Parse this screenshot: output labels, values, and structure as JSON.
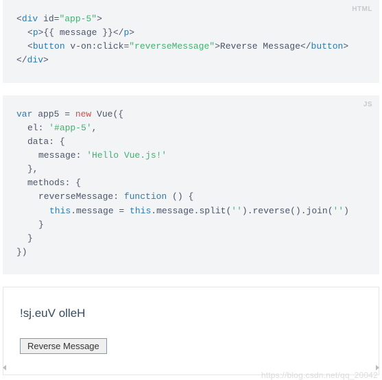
{
  "blocks": {
    "html": {
      "badge": "HTML",
      "lines": [
        {
          "indent": 0,
          "parts": [
            [
              "punct",
              "<"
            ],
            [
              "tag",
              "div "
            ],
            [
              "attr-name",
              "id"
            ],
            [
              "punct",
              "="
            ],
            [
              "attr-value",
              "\"app-5\""
            ],
            [
              "punct",
              ">"
            ]
          ]
        },
        {
          "indent": 1,
          "parts": [
            [
              "punct",
              "<"
            ],
            [
              "tag",
              "p"
            ],
            [
              "punct",
              ">"
            ],
            [
              "text",
              "{{ message }}"
            ],
            [
              "punct",
              "</"
            ],
            [
              "tag",
              "p"
            ],
            [
              "punct",
              ">"
            ]
          ]
        },
        {
          "indent": 1,
          "parts": [
            [
              "punct",
              "<"
            ],
            [
              "tag",
              "button "
            ],
            [
              "attr-name",
              "v-on:click"
            ],
            [
              "punct",
              "="
            ],
            [
              "attr-value",
              "\"reverseMessage\""
            ],
            [
              "punct",
              ">"
            ],
            [
              "text",
              "Reverse Message"
            ],
            [
              "punct",
              "</"
            ],
            [
              "tag",
              "button"
            ],
            [
              "punct",
              ">"
            ]
          ]
        },
        {
          "indent": 0,
          "parts": [
            [
              "punct",
              "</"
            ],
            [
              "tag",
              "div"
            ],
            [
              "punct",
              ">"
            ]
          ]
        }
      ]
    },
    "js": {
      "badge": "JS",
      "lines": [
        {
          "indent": 0,
          "parts": [
            [
              "keyword",
              "var"
            ],
            [
              "text",
              " app5 = "
            ],
            [
              "keyword2",
              "new"
            ],
            [
              "text",
              " Vue({"
            ]
          ]
        },
        {
          "indent": 1,
          "parts": [
            [
              "prop",
              "el"
            ],
            [
              "text",
              ": "
            ],
            [
              "string",
              "'#app-5'"
            ],
            [
              "text",
              ","
            ]
          ]
        },
        {
          "indent": 1,
          "parts": [
            [
              "prop",
              "data"
            ],
            [
              "text",
              ": {"
            ]
          ]
        },
        {
          "indent": 2,
          "parts": [
            [
              "prop",
              "message"
            ],
            [
              "text",
              ": "
            ],
            [
              "string",
              "'Hello Vue.js!'"
            ]
          ]
        },
        {
          "indent": 1,
          "parts": [
            [
              "text",
              "},"
            ]
          ]
        },
        {
          "indent": 1,
          "parts": [
            [
              "prop",
              "methods"
            ],
            [
              "text",
              ": {"
            ]
          ]
        },
        {
          "indent": 2,
          "parts": [
            [
              "prop",
              "reverseMessage"
            ],
            [
              "text",
              ": "
            ],
            [
              "keyword",
              "function"
            ],
            [
              "text",
              " () {"
            ]
          ]
        },
        {
          "indent": 3,
          "parts": [
            [
              "keyword",
              "this"
            ],
            [
              "text",
              ".message = "
            ],
            [
              "keyword",
              "this"
            ],
            [
              "text",
              ".message.split("
            ],
            [
              "string",
              "''"
            ],
            [
              "text",
              ").reverse().join("
            ],
            [
              "string",
              "''"
            ],
            [
              "text",
              ")"
            ]
          ]
        },
        {
          "indent": 2,
          "parts": [
            [
              "text",
              "}"
            ]
          ]
        },
        {
          "indent": 1,
          "parts": [
            [
              "text",
              "}"
            ]
          ]
        },
        {
          "indent": 0,
          "parts": [
            [
              "text",
              "})"
            ]
          ]
        }
      ]
    }
  },
  "output": {
    "text": "!sj.euV olleH",
    "button": "Reverse Message"
  },
  "watermark": "https://blog.csdn.net/qq_20042"
}
